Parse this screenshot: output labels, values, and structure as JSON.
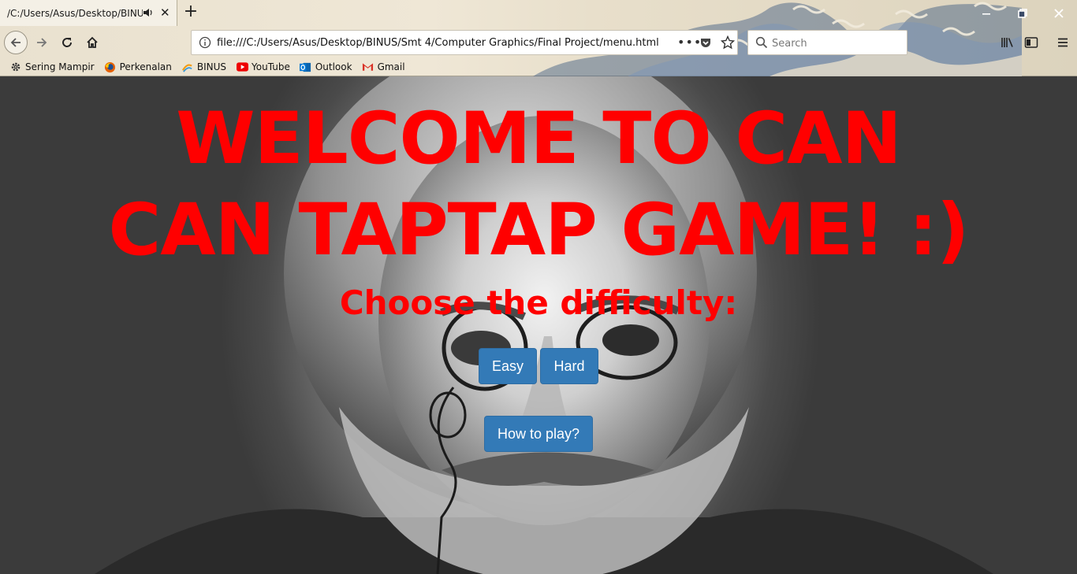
{
  "browser": {
    "tab_title": "/C:/Users/Asus/Desktop/BINUS/",
    "url": "file:///C:/Users/Asus/Desktop/BINUS/Smt 4/Computer Graphics/Final Project/menu.html",
    "search_placeholder": "Search",
    "bookmarks": [
      {
        "label": "Sering Mampir",
        "icon": "gear-icon"
      },
      {
        "label": "Perkenalan",
        "icon": "firefox-icon"
      },
      {
        "label": "BINUS",
        "icon": "binus-icon"
      },
      {
        "label": "YouTube",
        "icon": "youtube-icon"
      },
      {
        "label": "Outlook",
        "icon": "outlook-icon"
      },
      {
        "label": "Gmail",
        "icon": "gmail-icon"
      }
    ]
  },
  "page": {
    "heading": "WELCOME TO CAN CAN TAPTAP GAME! :)",
    "subheading": "Choose the difficulty:",
    "easy_label": "Easy",
    "hard_label": "Hard",
    "howto_label": "How to play?",
    "text_color": "#ff0000",
    "button_color": "#337ab7"
  }
}
